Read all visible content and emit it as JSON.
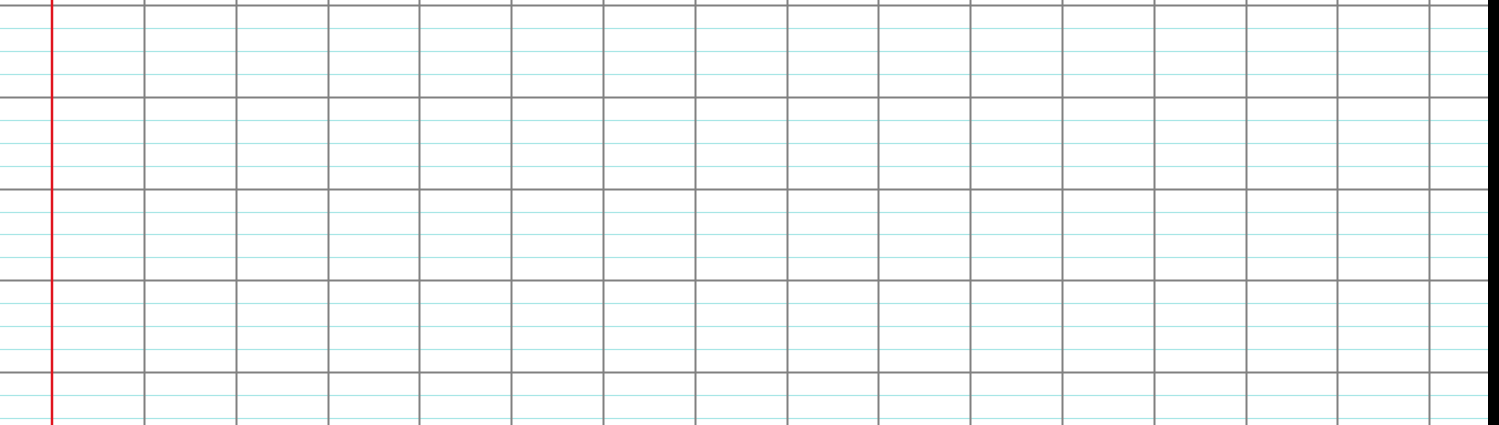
{
  "paper": {
    "style": "seyes-ruled-notebook-page",
    "background_color": "#ffffff",
    "major_grid_color": "#808080",
    "minor_ruling_color": "#a8e6e6",
    "margin_line_color": "#e0141e",
    "edge_color": "#000000",
    "minor_lines_per_square": 4
  }
}
